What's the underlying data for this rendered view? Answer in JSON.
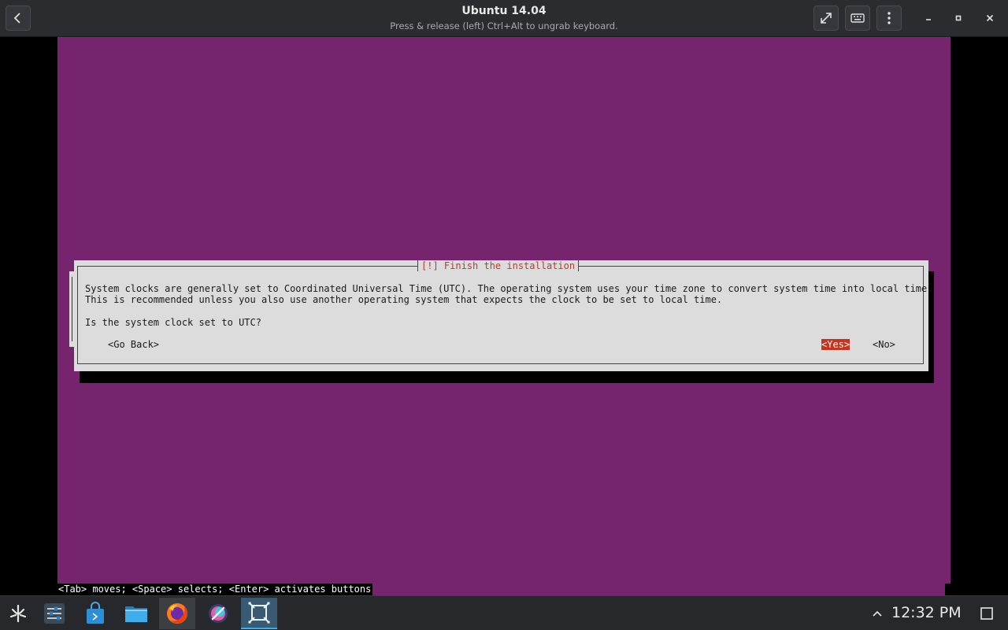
{
  "window": {
    "title": "Ubuntu 14.04",
    "subtitle": "Press & release (left) Ctrl+Alt to ungrab keyboard."
  },
  "toolbar_icons": [
    "back-arrow-icon",
    "fullscreen-icon",
    "keyboard-icon",
    "kebab-menu-icon",
    "minimize-icon",
    "maximize-icon",
    "close-icon"
  ],
  "installer": {
    "screen_bg": "#77246f",
    "dialog": {
      "title": "[!] Finish the installation",
      "message_line1": "System clocks are generally set to Coordinated Universal Time (UTC). The operating system uses your time zone to convert system time into local time.",
      "message_line2": "This is recommended unless you also use another operating system that expects the clock to be set to local time.",
      "question": "Is the system clock set to UTC?",
      "go_back": "<Go Back>",
      "yes": "<Yes>",
      "no": "<No>",
      "selected": "yes",
      "selected_color": "#c8331e"
    },
    "hint": "<Tab> moves; <Space> selects; <Enter> activates buttons"
  },
  "taskbar": {
    "items": [
      {
        "name": "app-launcher",
        "icon": "app-launcher-icon"
      },
      {
        "name": "settings",
        "icon": "settings-sliders-icon"
      },
      {
        "name": "discover-store",
        "icon": "store-bag-icon"
      },
      {
        "name": "files",
        "icon": "folder-icon"
      },
      {
        "name": "firefox",
        "icon": "firefox-icon"
      },
      {
        "name": "krita",
        "icon": "krita-icon"
      },
      {
        "name": "virtual-machine",
        "icon": "vm-icon",
        "active": true
      }
    ],
    "clock": "12:32 PM",
    "accent": "#3daee9"
  }
}
